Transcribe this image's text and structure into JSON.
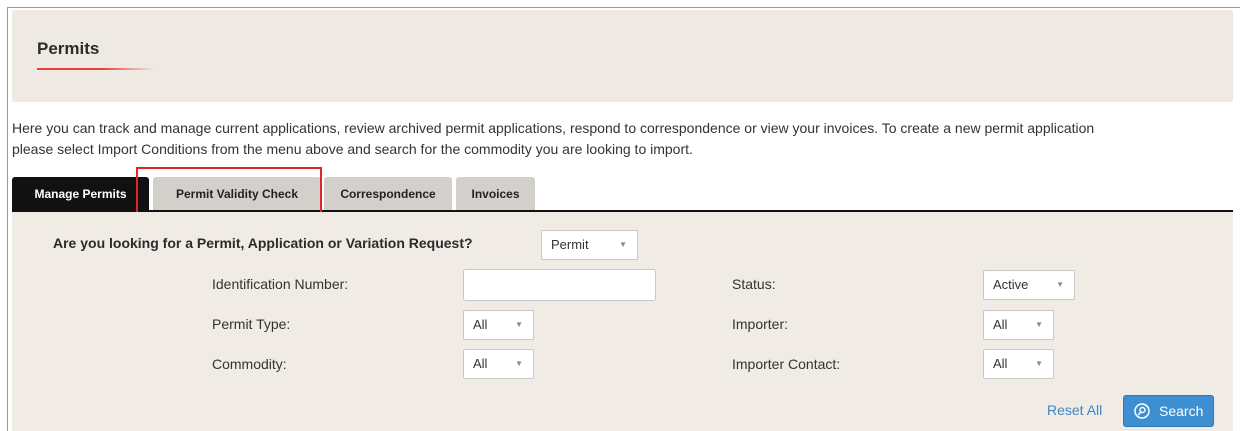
{
  "header": {
    "title": "Permits"
  },
  "intro": {
    "line1": "Here you can track and manage current applications, review archived permit applications, respond to correspondence or view your invoices. To create a new permit application",
    "line2": "please select Import Conditions from the menu above and search for the commodity you are looking to import."
  },
  "tabs": [
    {
      "label": "Manage Permits",
      "active": true
    },
    {
      "label": "Permit Validity Check",
      "active": false,
      "highlighted": true
    },
    {
      "label": "Correspondence",
      "active": false
    },
    {
      "label": "Invoices",
      "active": false
    }
  ],
  "form": {
    "question": "Are you looking for a Permit, Application or Variation Request?",
    "request_type": "Permit",
    "identification_number": {
      "label": "Identification Number:",
      "value": ""
    },
    "permit_type": {
      "label": "Permit Type:",
      "value": "All"
    },
    "commodity": {
      "label": "Commodity:",
      "value": "All"
    },
    "status": {
      "label": "Status:",
      "value": "Active"
    },
    "importer": {
      "label": "Importer:",
      "value": "All"
    },
    "importer_contact": {
      "label": "Importer Contact:",
      "value": "All"
    }
  },
  "actions": {
    "reset": "Reset All",
    "search": "Search",
    "search_icon": "search-icon"
  },
  "colors": {
    "header_bg": "#efe9e3",
    "accent_red": "#e8403a",
    "highlight_red": "#e0262b",
    "link_blue": "#3e86c8",
    "button_blue": "#3d8fd1"
  }
}
